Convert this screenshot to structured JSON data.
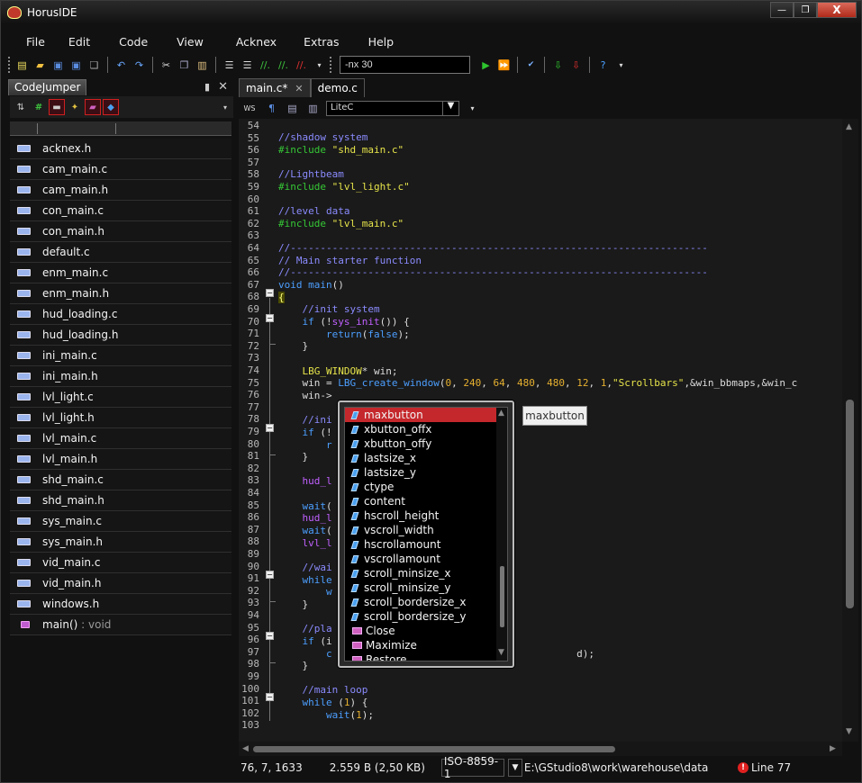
{
  "window": {
    "title": "HorusIDE",
    "controls": [
      "—",
      "❐",
      "X"
    ]
  },
  "menu": [
    "File",
    "Edit",
    "Code",
    "View",
    "Acknex",
    "Extras",
    "Help"
  ],
  "toolbar": {
    "command_input": "-nx 30"
  },
  "left_panel": {
    "title": "CodeJumper",
    "files": [
      "acknex.h",
      "cam_main.c",
      "cam_main.h",
      "con_main.c",
      "con_main.h",
      "default.c",
      "enm_main.c",
      "enm_main.h",
      "hud_loading.c",
      "hud_loading.h",
      "ini_main.c",
      "ini_main.h",
      "lvl_light.c",
      "lvl_light.h",
      "lvl_main.c",
      "lvl_main.h",
      "shd_main.c",
      "shd_main.h",
      "sys_main.c",
      "sys_main.h",
      "vid_main.c",
      "vid_main.h",
      "windows.h"
    ],
    "function_item": {
      "name": "main()",
      "type": " : void"
    }
  },
  "editor": {
    "tabs": [
      {
        "label": "main.c*",
        "active": true
      },
      {
        "label": "demo.c",
        "active": false
      }
    ],
    "ws_label": "WS",
    "language": "LiteC",
    "line_numbers": [
      "54",
      "55",
      "56",
      "57",
      "58",
      "59",
      "60",
      "61",
      "62",
      "63",
      "64",
      "65",
      "66",
      "67",
      "68",
      "69",
      "70",
      "71",
      "72",
      "73",
      "74",
      "75",
      "76",
      "77",
      "78",
      "79",
      "80",
      "81",
      "82",
      "83",
      "84",
      "85",
      "86",
      "87",
      "88",
      "89",
      "90",
      "91",
      "92",
      "93",
      "94",
      "95",
      "96",
      "97",
      "98",
      "99",
      "100",
      "101",
      "102",
      "103"
    ]
  },
  "autocomplete": {
    "items": [
      "maxbutton",
      "xbutton_offx",
      "xbutton_offy",
      "lastsize_x",
      "lastsize_y",
      "ctype",
      "content",
      "hscroll_height",
      "vscroll_width",
      "hscrollamount",
      "vscrollamount",
      "scroll_minsize_x",
      "scroll_minsize_y",
      "scroll_bordersize_x",
      "scroll_bordersize_y",
      "Close",
      "Maximize",
      "Restore"
    ],
    "selected": "maxbutton",
    "tooltip": "maxbutton"
  },
  "status": {
    "position": "76,   7,   1633",
    "size": "2.559 B (2,50 KB)",
    "encoding": "ISO-8859-1",
    "path": "E:\\GStudio8\\work\\warehouse\\data",
    "error": "Line 77"
  },
  "colors": {
    "selection": "#c5282c",
    "comment": "#8b8bff",
    "directive": "#35c735",
    "string": "#e6e44a",
    "keyword": "#4c9fff"
  }
}
